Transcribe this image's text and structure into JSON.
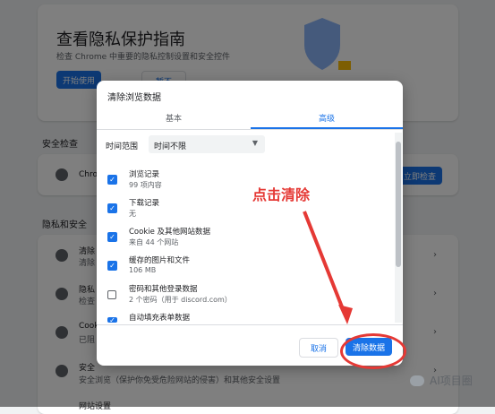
{
  "privacy_page": {
    "hero_title": "查看隐私保护指南",
    "hero_subtitle": "检查 Chrome 中重要的隐私控制设置和安全控件",
    "hero_start_button": "开始使用",
    "hero_second_button": "暂不",
    "safety_check_heading": "安全检查",
    "safety_check_row_text": "Chro",
    "safety_check_button": "立即检查",
    "privacy_heading": "隐私和安全",
    "rows": [
      {
        "title": "清除",
        "subtitle": "清除"
      },
      {
        "title": "隐私",
        "subtitle": "检查"
      },
      {
        "title": "Cook",
        "subtitle": "已阻"
      },
      {
        "title": "安全",
        "subtitle": "安全浏览（保护你免受危险网站的侵害）和其他安全设置"
      },
      {
        "title": "网站设置",
        "subtitle": ""
      }
    ]
  },
  "dialog": {
    "title": "清除浏览数据",
    "tabs": [
      {
        "label": "基本"
      },
      {
        "label": "高级"
      }
    ],
    "time_range_label": "时间范围",
    "time_range_value": "时间不限",
    "items": [
      {
        "label": "浏览记录",
        "detail": "99 项内容",
        "checked": true
      },
      {
        "label": "下载记录",
        "detail": "无",
        "checked": true
      },
      {
        "label": "Cookie 及其他网站数据",
        "detail": "来自 44 个网站",
        "checked": true
      },
      {
        "label": "缓存的图片和文件",
        "detail": "106 MB",
        "checked": true
      },
      {
        "label": "密码和其他登录数据",
        "detail": "2 个密码（用于 discord.com）",
        "checked": false
      },
      {
        "label": "自动填充表单数据",
        "detail": "",
        "checked": true
      }
    ],
    "cancel_button": "取消",
    "clear_button": "清除数据"
  },
  "annotation": {
    "text": "点击清除",
    "color": "#e53935"
  },
  "watermark": {
    "text": "AI项目圈"
  },
  "colors": {
    "accent": "#1a73e8"
  }
}
